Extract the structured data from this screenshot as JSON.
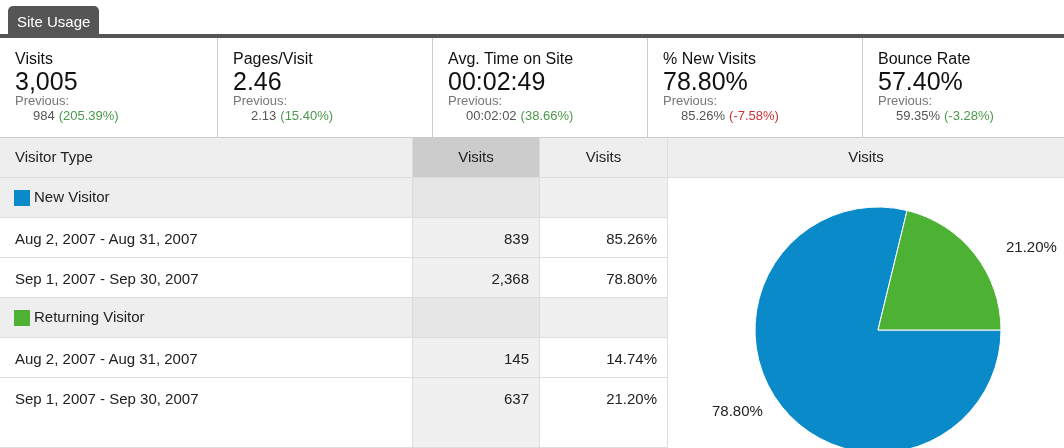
{
  "tabs": [
    {
      "label": "Site Usage",
      "selected": true
    }
  ],
  "metrics": [
    {
      "label": "Visits",
      "value": "3,005",
      "previous_label": "Previous:",
      "previous": "984",
      "change": "(205.39%)",
      "good": true
    },
    {
      "label": "Pages/Visit",
      "value": "2.46",
      "previous_label": "Previous:",
      "previous": "2.13",
      "change": "(15.40%)",
      "good": true
    },
    {
      "label": "Avg. Time on Site",
      "value": "00:02:49",
      "previous_label": "Previous:",
      "previous": "00:02:02",
      "change": "(38.66%)",
      "good": true
    },
    {
      "label": "% New Visits",
      "value": "78.80%",
      "previous_label": "Previous:",
      "previous": "85.26%",
      "change": "(-7.58%)",
      "good": false
    },
    {
      "label": "Bounce Rate",
      "value": "57.40%",
      "previous_label": "Previous:",
      "previous": "59.35%",
      "change": "(-3.28%)",
      "good": true
    }
  ],
  "table": {
    "columns": [
      {
        "label": "Visitor Type",
        "sorted": false
      },
      {
        "label": "Visits",
        "sorted": true
      },
      {
        "label": "Visits",
        "sorted": false
      }
    ],
    "groups": [
      {
        "label": "New Visitor",
        "color": "#0a8ac8",
        "rows": [
          [
            "Aug 2, 2007 - Aug 31, 2007",
            "839",
            "85.26%"
          ],
          [
            "Sep 1, 2007 - Sep 30, 2007",
            "2,368",
            "78.80%"
          ]
        ]
      },
      {
        "label": "Returning Visitor",
        "color": "#4db133",
        "rows": [
          [
            "Aug 2, 2007 - Aug 31, 2007",
            "145",
            "14.74%"
          ],
          [
            "Sep 1, 2007 - Sep 30, 2007",
            "637",
            "21.20%"
          ]
        ]
      }
    ]
  },
  "chart": {
    "header": "Visits",
    "chart_data": {
      "type": "pie",
      "values": [
        78.8,
        21.2
      ],
      "value_labels": [
        "78.80%",
        "21.20%"
      ],
      "colors": [
        "#0a8ac8",
        "#4db133"
      ]
    }
  }
}
